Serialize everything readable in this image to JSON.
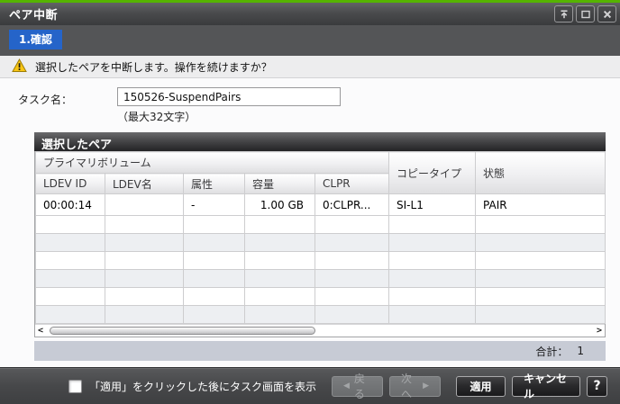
{
  "window": {
    "title": "ペア中断"
  },
  "steps": {
    "current": "1.確認"
  },
  "warning": {
    "message": "選択したペアを中断します。操作を続けますか？"
  },
  "task": {
    "label": "タスク名：",
    "value": "150526-SuspendPairs",
    "hint": "（最大32文字）"
  },
  "table": {
    "title": "選択したペア",
    "group_header": "プライマリボリューム",
    "columns": [
      "LDEV ID",
      "LDEV名",
      "属性",
      "容量",
      "CLPR"
    ],
    "span_columns": [
      "コピータイプ",
      "状態"
    ],
    "rows": [
      {
        "ldev_id": "00:00:14",
        "ldev_name": "",
        "attribute": "-",
        "capacity": "1.00 GB",
        "clpr": "0:CLPR...",
        "copy_type": "SI-L1",
        "status": "PAIR"
      }
    ],
    "total_label": "合計：",
    "total_value": "1"
  },
  "footer": {
    "checkbox_label": "「適用」をクリックした後にタスク画面を表示",
    "checkbox_checked": false,
    "back_label": "戻る",
    "next_label": "次へ",
    "apply_label": "適用",
    "cancel_label": "キャンセル",
    "help_label": "?"
  },
  "icons": {
    "back_arrow": "◀",
    "next_arrow": "▶",
    "scroll_left": "<",
    "scroll_right": ">"
  },
  "colors": {
    "accent_green": "#55b400",
    "step_tab_blue": "#2564c9",
    "table_footer_bg": "#c7cbd5"
  }
}
